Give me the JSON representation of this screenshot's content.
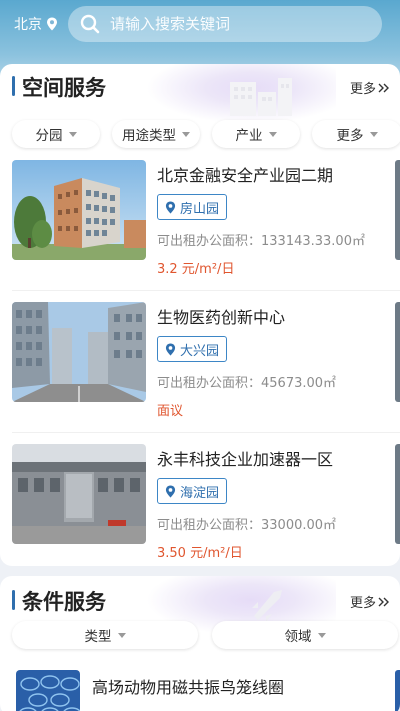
{
  "header": {
    "city": "北京",
    "search_placeholder": "请输入搜索关键词"
  },
  "space_service": {
    "title": "空间服务",
    "more": "更多",
    "filters": [
      "分园",
      "用途类型",
      "产业",
      "更多"
    ],
    "listings": [
      {
        "title": "北京金融安全产业园二期",
        "district": "房山园",
        "area": "可出租办公面积：133143.33.00㎡",
        "price": "3.2 元/m²/日"
      },
      {
        "title": "生物医药创新中心",
        "district": "大兴园",
        "area": "可出租办公面积：45673.00㎡",
        "price": "面议"
      },
      {
        "title": "永丰科技企业加速器一区",
        "district": "海淀园",
        "area": "可出租办公面积：33000.00㎡",
        "price": "3.50 元/m²/日"
      }
    ]
  },
  "condition_service": {
    "title": "条件服务",
    "more": "更多",
    "filters": [
      "类型",
      "领域"
    ],
    "items": [
      {
        "title": "高场动物用磁共振鸟笼线圈"
      }
    ]
  },
  "colors": {
    "accent": "#2f6fae",
    "price": "#e0562f",
    "header_top": "#5aa8cf"
  },
  "icons": [
    "location-pin-icon",
    "search-icon",
    "double-chevron-right-icon",
    "caret-down-icon"
  ]
}
